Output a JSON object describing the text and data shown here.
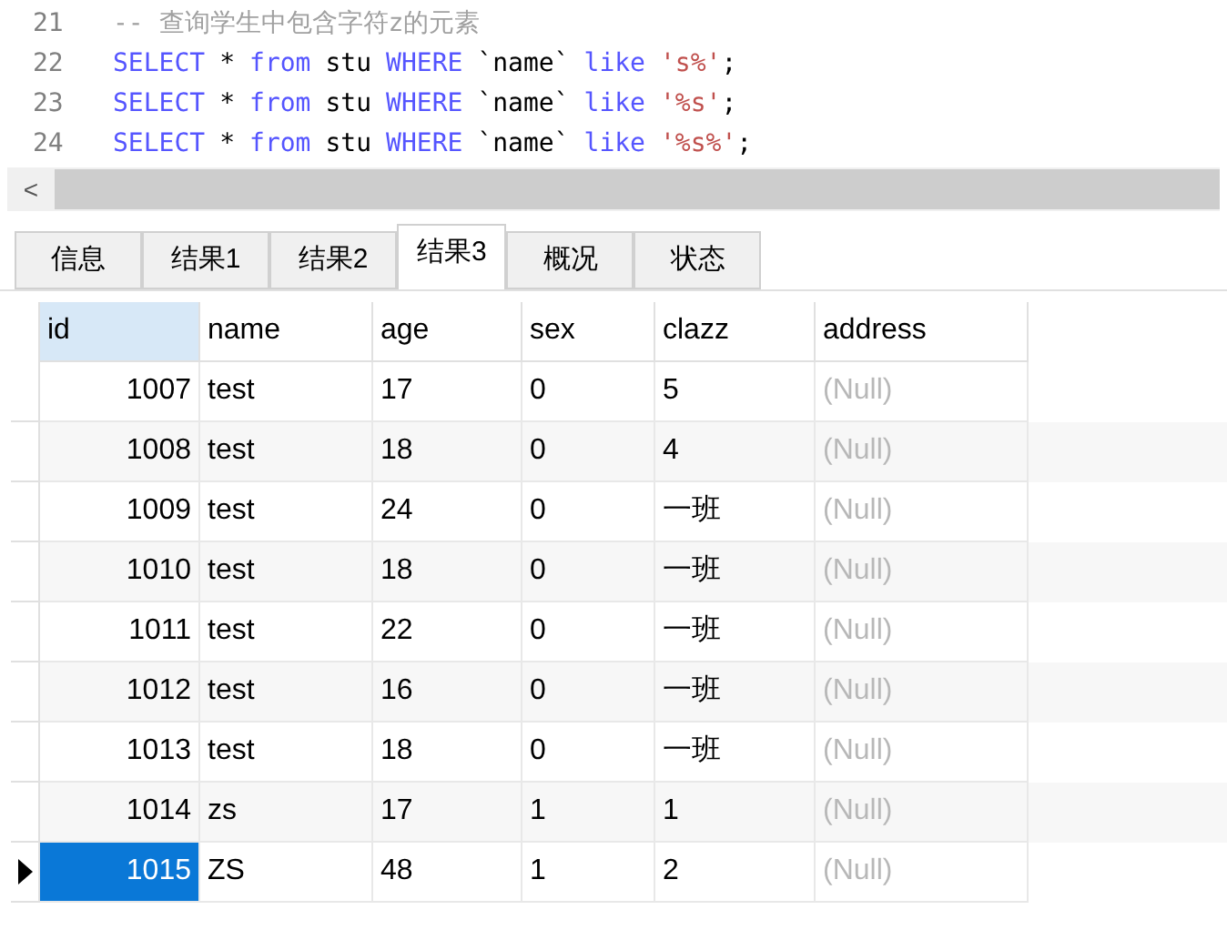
{
  "editor": {
    "lines": [
      {
        "number": "21",
        "tokens": [
          {
            "kind": "comment",
            "text": "-- 查询学生中包含字符z的元素"
          }
        ]
      },
      {
        "number": "22",
        "tokens": [
          {
            "kind": "keyword",
            "text": "SELECT"
          },
          {
            "kind": "plain",
            "text": "*"
          },
          {
            "kind": "keyword",
            "text": "from"
          },
          {
            "kind": "plain",
            "text": "stu"
          },
          {
            "kind": "keyword",
            "text": "WHERE"
          },
          {
            "kind": "plain",
            "text": "`name`"
          },
          {
            "kind": "keyword",
            "text": "like"
          },
          {
            "kind": "string",
            "text": "'s%'"
          },
          {
            "kind": "glued",
            "text": ";"
          }
        ]
      },
      {
        "number": "23",
        "tokens": [
          {
            "kind": "keyword",
            "text": "SELECT"
          },
          {
            "kind": "plain",
            "text": "*"
          },
          {
            "kind": "keyword",
            "text": "from"
          },
          {
            "kind": "plain",
            "text": "stu"
          },
          {
            "kind": "keyword",
            "text": "WHERE"
          },
          {
            "kind": "plain",
            "text": "`name`"
          },
          {
            "kind": "keyword",
            "text": "like"
          },
          {
            "kind": "string",
            "text": "'%s'"
          },
          {
            "kind": "glued",
            "text": ";"
          }
        ]
      },
      {
        "number": "24",
        "tokens": [
          {
            "kind": "keyword",
            "text": "SELECT"
          },
          {
            "kind": "plain",
            "text": "*"
          },
          {
            "kind": "keyword",
            "text": "from"
          },
          {
            "kind": "plain",
            "text": "stu"
          },
          {
            "kind": "keyword",
            "text": "WHERE"
          },
          {
            "kind": "plain",
            "text": "`name`"
          },
          {
            "kind": "keyword",
            "text": "like"
          },
          {
            "kind": "string",
            "text": "'%s%'"
          },
          {
            "kind": "glued",
            "text": ";"
          }
        ]
      }
    ]
  },
  "scrollbar": {
    "arrow": "<"
  },
  "tabs": [
    {
      "label": "信息",
      "selected": false
    },
    {
      "label": "结果1",
      "selected": false
    },
    {
      "label": "结果2",
      "selected": false
    },
    {
      "label": "结果3",
      "selected": true
    },
    {
      "label": "概况",
      "selected": false
    },
    {
      "label": "状态",
      "selected": false
    }
  ],
  "table": {
    "columns": [
      {
        "label": "id",
        "selected": true
      },
      {
        "label": "name",
        "selected": false
      },
      {
        "label": "age",
        "selected": false
      },
      {
        "label": "sex",
        "selected": false
      },
      {
        "label": "clazz",
        "selected": false
      },
      {
        "label": "address",
        "selected": false
      }
    ],
    "rows": [
      {
        "selected": false,
        "cells": [
          "1007",
          "test",
          "17",
          "0",
          "5",
          "(Null)"
        ]
      },
      {
        "selected": false,
        "cells": [
          "1008",
          "test",
          "18",
          "0",
          "4",
          "(Null)"
        ]
      },
      {
        "selected": false,
        "cells": [
          "1009",
          "test",
          "24",
          "0",
          "一班",
          "(Null)"
        ]
      },
      {
        "selected": false,
        "cells": [
          "1010",
          "test",
          "18",
          "0",
          "一班",
          "(Null)"
        ]
      },
      {
        "selected": false,
        "cells": [
          "1011",
          "test",
          "22",
          "0",
          "一班",
          "(Null)"
        ]
      },
      {
        "selected": false,
        "cells": [
          "1012",
          "test",
          "16",
          "0",
          "一班",
          "(Null)"
        ]
      },
      {
        "selected": false,
        "cells": [
          "1013",
          "test",
          "18",
          "0",
          "一班",
          "(Null)"
        ]
      },
      {
        "selected": false,
        "cells": [
          "1014",
          "zs",
          "17",
          "1",
          "1",
          "(Null)"
        ]
      },
      {
        "selected": true,
        "cells": [
          "1015",
          "ZS",
          "48",
          "1",
          "2",
          "(Null)"
        ]
      }
    ]
  }
}
